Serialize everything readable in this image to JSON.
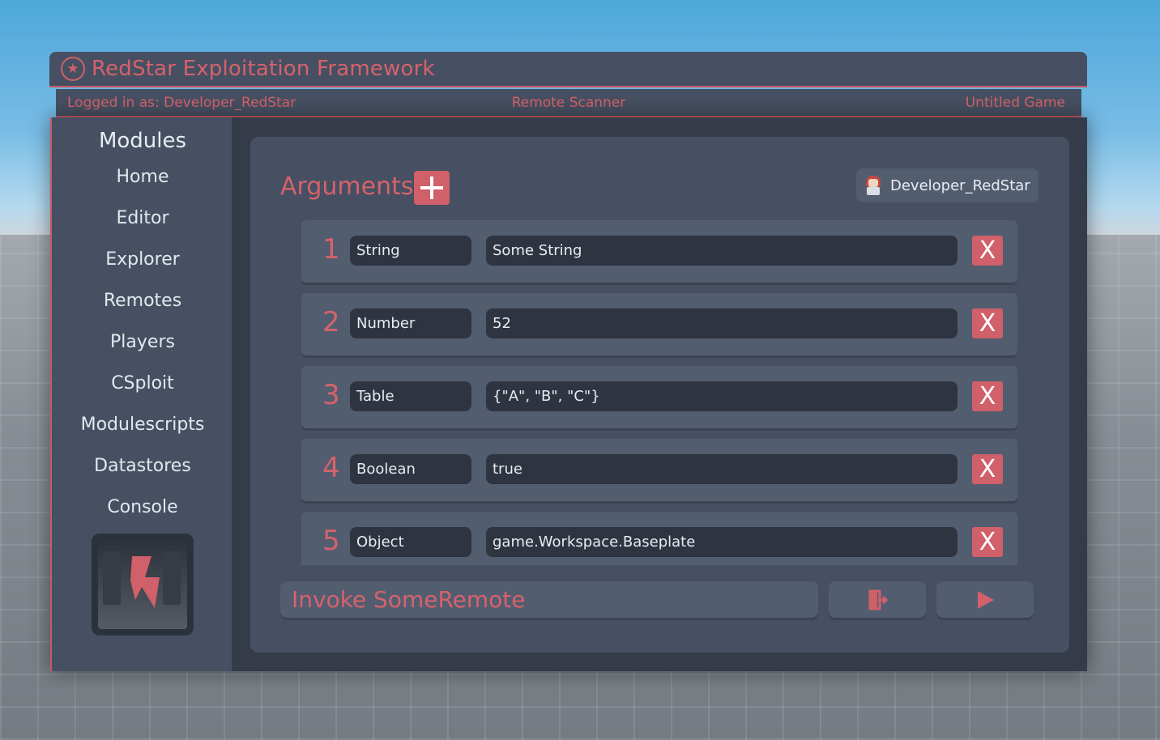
{
  "window": {
    "title": "RedStar Exploitation Framework",
    "logo_icon": "star-circle-icon",
    "accent_color": "#d6626b"
  },
  "status": {
    "logged_in": "Logged in as: Developer_RedStar",
    "section": "Remote Scanner",
    "game": "Untitled Game"
  },
  "sidebar": {
    "title": "Modules",
    "items": [
      {
        "label": "Home"
      },
      {
        "label": "Editor"
      },
      {
        "label": "Explorer"
      },
      {
        "label": "Remotes"
      },
      {
        "label": "Players"
      },
      {
        "label": "CSploit"
      },
      {
        "label": "Modulescripts"
      },
      {
        "label": "Datastores"
      },
      {
        "label": "Console"
      }
    ],
    "thumbnail_icon": "lightning-bolt-icon"
  },
  "main": {
    "arguments_title": "Arguments",
    "add_icon": "plus-icon",
    "user": "Developer_RedStar",
    "arguments": [
      {
        "index": "1",
        "type": "String",
        "value": "Some String",
        "remove": "X"
      },
      {
        "index": "2",
        "type": "Number",
        "value": "52",
        "remove": "X"
      },
      {
        "index": "3",
        "type": "Table",
        "value": "{\"A\", \"B\", \"C\"}",
        "remove": "X"
      },
      {
        "index": "4",
        "type": "Boolean",
        "value": "true",
        "remove": "X"
      },
      {
        "index": "5",
        "type": "Object",
        "value": "game.Workspace.Baseplate",
        "remove": "X"
      }
    ],
    "invoke_label": "Invoke SomeRemote",
    "exit_icon": "exit-door-icon",
    "run_icon": "play-icon"
  }
}
